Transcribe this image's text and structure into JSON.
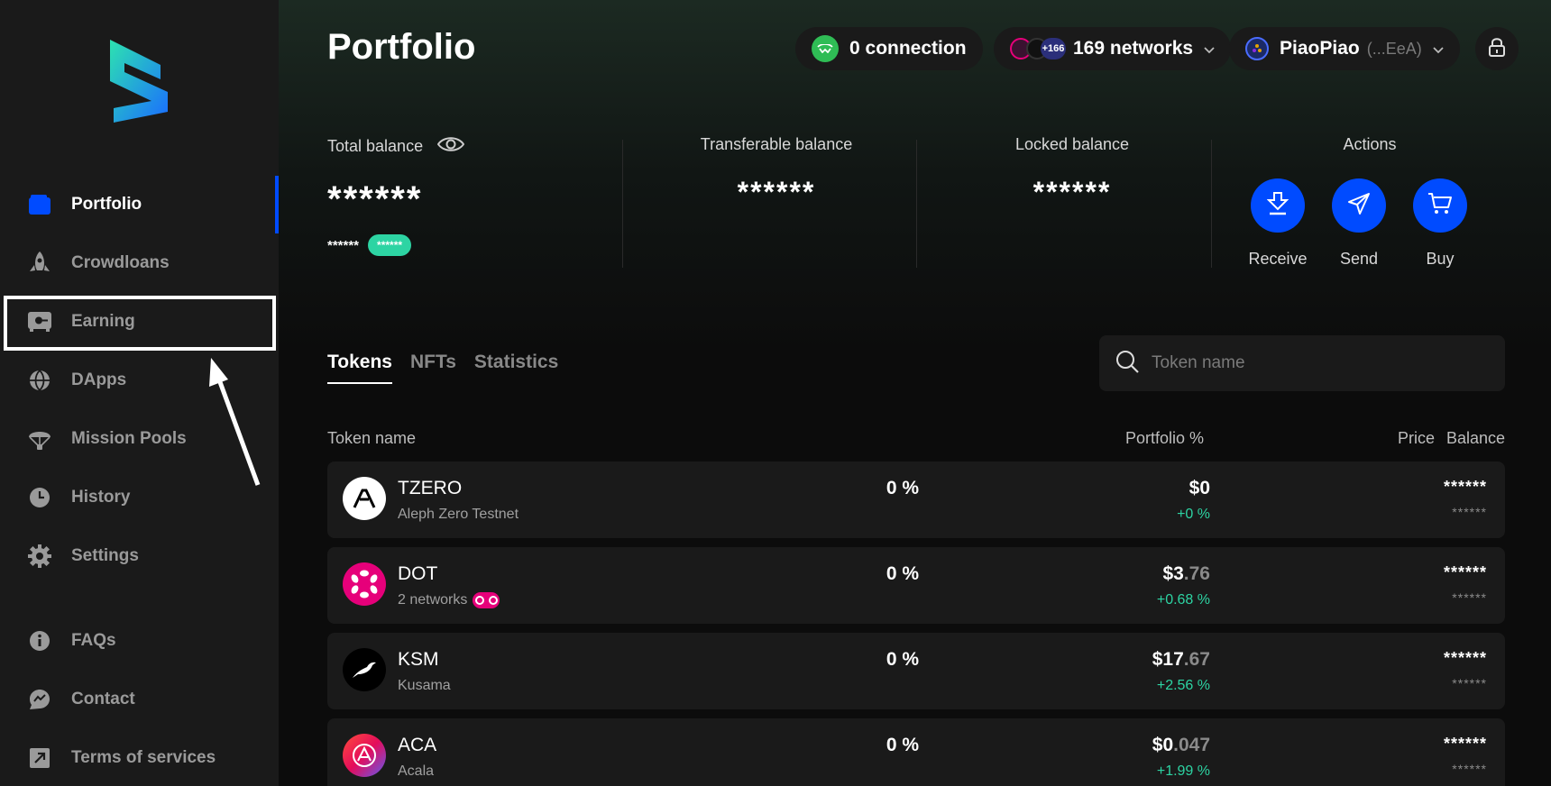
{
  "sidebar": {
    "items": [
      {
        "label": "Portfolio",
        "icon": "wallet-icon"
      },
      {
        "label": "Crowdloans",
        "icon": "rocket-icon"
      },
      {
        "label": "Earning",
        "icon": "safe-icon"
      },
      {
        "label": "DApps",
        "icon": "globe-icon"
      },
      {
        "label": "Mission Pools",
        "icon": "parachute-icon"
      },
      {
        "label": "History",
        "icon": "clock-icon"
      },
      {
        "label": "Settings",
        "icon": "gear-icon"
      },
      {
        "label": "FAQs",
        "icon": "info-icon"
      },
      {
        "label": "Contact",
        "icon": "chat-icon"
      },
      {
        "label": "Terms of services",
        "icon": "external-link-icon"
      }
    ],
    "active": "Portfolio"
  },
  "header": {
    "title": "Portfolio",
    "connection": "0 connection",
    "networks_badge": "+166",
    "networks": "169 networks",
    "account_name": "PiaoPiao",
    "account_addr": "(...EeA)"
  },
  "balances": {
    "total_label": "Total balance",
    "total_value": "******",
    "total_sub": "******",
    "total_badge": "******",
    "transferable_label": "Transferable balance",
    "transferable_value": "******",
    "locked_label": "Locked balance",
    "locked_value": "******",
    "actions_label": "Actions",
    "actions": [
      "Receive",
      "Send",
      "Buy"
    ]
  },
  "tabs": [
    "Tokens",
    "NFTs",
    "Statistics"
  ],
  "search": {
    "placeholder": "Token name"
  },
  "table": {
    "headers": [
      "Token name",
      "Portfolio %",
      "Price",
      "Balance"
    ],
    "rows": [
      {
        "symbol": "TZERO",
        "sub": "Aleph Zero Testnet",
        "pct": "0 %",
        "price_int": "$0",
        "price_dec": "",
        "change": "+0 %",
        "bal1": "******",
        "bal2": "******",
        "color": "#ffffff"
      },
      {
        "symbol": "DOT",
        "sub": "2 networks",
        "pct": "0 %",
        "price_int": "$3",
        "price_dec": ".76",
        "change": "+0.68 %",
        "bal1": "******",
        "bal2": "******",
        "color": "#e6007a"
      },
      {
        "symbol": "KSM",
        "sub": "Kusama",
        "pct": "0 %",
        "price_int": "$17",
        "price_dec": ".67",
        "change": "+2.56 %",
        "bal1": "******",
        "bal2": "******",
        "color": "#000000"
      },
      {
        "symbol": "ACA",
        "sub": "Acala",
        "pct": "0 %",
        "price_int": "$0",
        "price_dec": ".047",
        "change": "+1.99 %",
        "bal1": "******",
        "bal2": "******",
        "color": "#e40c5b"
      }
    ]
  },
  "colors": {
    "accent": "#004bff",
    "positive": "#2dd4a3",
    "connection": "#2fbc55"
  }
}
